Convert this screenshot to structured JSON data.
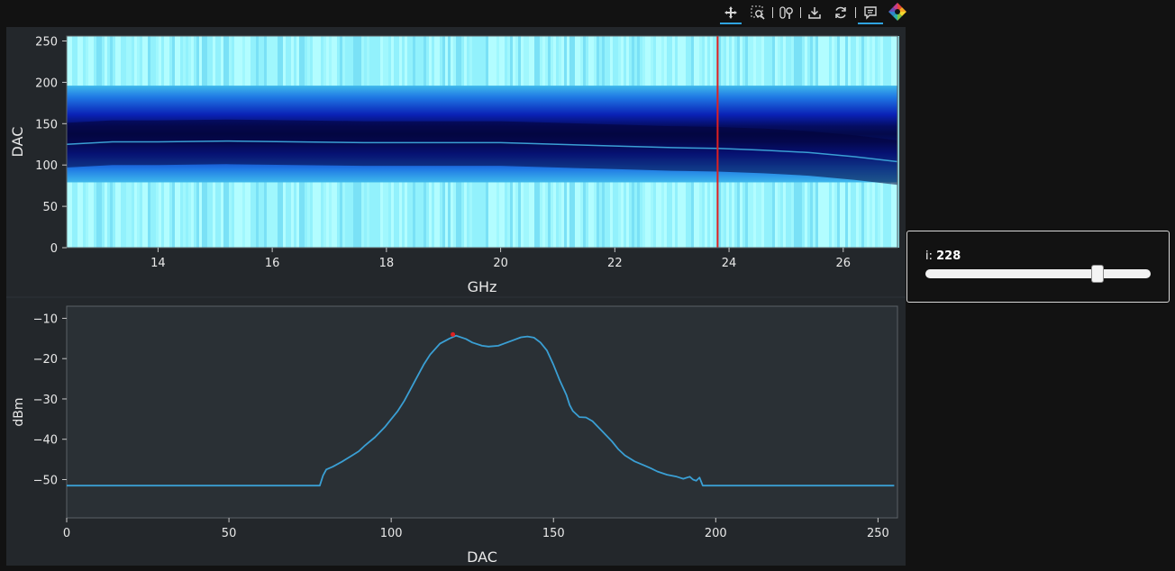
{
  "toolbar": {
    "tools": [
      "pan-tool",
      "box-zoom-tool",
      "wheel-zoom-tool",
      "save-tool",
      "reset-tool",
      "hover-tool"
    ]
  },
  "slider": {
    "label": "i: ",
    "value": "228",
    "value_num": 228,
    "min": 0,
    "max": 299
  },
  "chart_data": [
    {
      "type": "heatmap",
      "xlabel": "GHz",
      "ylabel": "DAC",
      "xlim": [
        12.4,
        26.95
      ],
      "ylim": [
        0,
        256
      ],
      "x_ticks": [
        14,
        16,
        18,
        20,
        22,
        24,
        26
      ],
      "y_ticks": [
        0,
        50,
        100,
        150,
        200,
        250
      ],
      "color_scale": [
        "#a8fbff",
        "#32c3ee",
        "#1a5de6",
        "#0c0f82",
        "#03043a"
      ],
      "overlay_line": {
        "color": "#3a9fd4",
        "x": [
          12.4,
          13.2,
          14.0,
          15.2,
          16.4,
          17.6,
          18.8,
          20.0,
          21.0,
          22.0,
          23.0,
          23.8,
          24.6,
          25.4,
          26.2,
          26.95
        ],
        "y": [
          125,
          128,
          128,
          129,
          128,
          127,
          127,
          127,
          125,
          123,
          121,
          120,
          118,
          115,
          110,
          104
        ]
      },
      "marker_line": {
        "color": "#e02020",
        "x": 23.8
      },
      "bands": {
        "low": 79,
        "high": 196
      }
    },
    {
      "type": "line",
      "xlabel": "DAC",
      "ylabel": "dBm",
      "xlim": [
        0,
        256
      ],
      "ylim": [
        -59.5,
        -7
      ],
      "x_ticks": [
        0,
        50,
        100,
        150,
        200,
        250
      ],
      "y_ticks": [
        -10,
        -20,
        -30,
        -40,
        -50
      ],
      "y_tick_labels": [
        "−10",
        "−20",
        "−30",
        "−40",
        "−50"
      ],
      "series": [
        {
          "color": "#3a9fd4",
          "x": [
            0,
            78,
            79,
            80,
            82,
            85,
            88,
            90,
            92,
            95,
            98,
            100,
            102,
            104,
            106,
            108,
            110,
            112,
            115,
            118,
            120,
            123,
            125,
            128,
            130,
            133,
            135,
            138,
            140,
            142,
            144,
            146,
            148,
            150,
            152,
            154,
            155,
            156,
            158,
            160,
            162,
            165,
            168,
            170,
            172,
            175,
            178,
            180,
            182,
            185,
            188,
            190,
            192,
            193,
            194,
            195,
            196,
            255
          ],
          "y": [
            -51.5,
            -51.5,
            -49.0,
            -47.5,
            -46.8,
            -45.5,
            -44.0,
            -43.0,
            -41.5,
            -39.5,
            -37.0,
            -35.0,
            -33.0,
            -30.5,
            -27.5,
            -24.5,
            -21.5,
            -19.0,
            -16.3,
            -15.0,
            -14.3,
            -15.1,
            -16.0,
            -16.8,
            -17.0,
            -16.8,
            -16.2,
            -15.3,
            -14.7,
            -14.5,
            -14.8,
            -16.0,
            -18.0,
            -21.5,
            -25.5,
            -29.0,
            -31.5,
            -33.0,
            -34.5,
            -34.6,
            -35.5,
            -38.0,
            -40.5,
            -42.5,
            -44.0,
            -45.5,
            -46.5,
            -47.2,
            -48.0,
            -48.8,
            -49.3,
            -49.8,
            -49.3,
            -50.0,
            -50.3,
            -49.5,
            -51.5,
            -51.5
          ]
        }
      ],
      "marker_point": {
        "color": "#e02020",
        "x": 119,
        "y": -14.0
      }
    }
  ]
}
